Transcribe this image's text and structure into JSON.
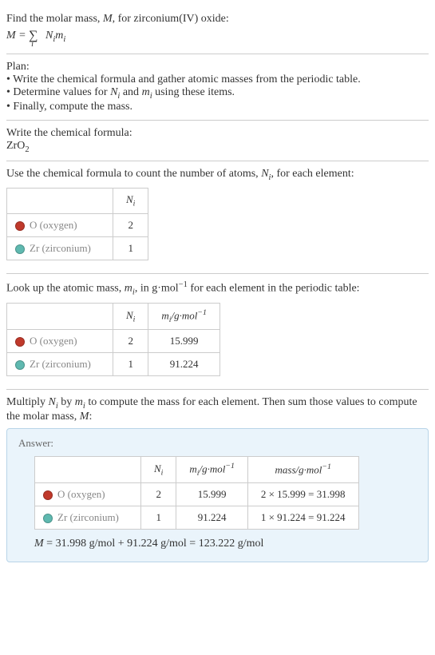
{
  "intro": {
    "line1_a": "Find the molar mass, ",
    "line1_b": ", for zirconium(IV) oxide:",
    "M": "M",
    "eq_lhs": "M = ",
    "sigma": "∑",
    "sigma_sub": "i",
    "eq_rhs_a": "N",
    "eq_rhs_b": "m"
  },
  "plan": {
    "title": "Plan:",
    "b1_a": "• Write the chemical formula and gather atomic masses from the periodic table.",
    "b2_a": "• Determine values for ",
    "b2_b": " and ",
    "b2_c": " using these items.",
    "b3": "• Finally, compute the mass."
  },
  "formula_section": {
    "title": "Write the chemical formula:",
    "zr": "ZrO",
    "sub2": "2"
  },
  "count_section": {
    "text_a": "Use the chemical formula to count the number of atoms, ",
    "text_b": ", for each element:",
    "N": "N",
    "i": "i"
  },
  "mass_section": {
    "text_a": "Look up the atomic mass, ",
    "text_b": ", in g·mol",
    "text_c": " for each element in the periodic table:",
    "m": "m",
    "i": "i",
    "neg1": "−1"
  },
  "multiply_section": {
    "text_a": "Multiply ",
    "text_b": " by ",
    "text_c": " to compute the mass for each element. Then sum those values to compute the molar mass, ",
    "text_d": ":",
    "N": "N",
    "m": "m",
    "i": "i",
    "M": "M"
  },
  "answer": {
    "label": "Answer:",
    "final_a": "M",
    "final_b": " = 31.998 g/mol + 91.224 g/mol = 123.222 g/mol"
  },
  "headers": {
    "N": "N",
    "m": "m",
    "i": "i",
    "gmol": "/g·mol",
    "neg1": "−1",
    "mass": "mass/g·mol"
  },
  "elements": {
    "o_name": "O (oxygen)",
    "zr_name": "Zr (zirconium)"
  },
  "chart_data": {
    "type": "table",
    "rows": [
      {
        "element": "O (oxygen)",
        "N_i": 2,
        "m_i": 15.999,
        "mass_expr": "2 × 15.999 = 31.998"
      },
      {
        "element": "Zr (zirconium)",
        "N_i": 1,
        "m_i": 91.224,
        "mass_expr": "1 × 91.224 = 91.224"
      }
    ],
    "molar_mass": 123.222
  },
  "vals": {
    "o_n": "2",
    "zr_n": "1",
    "o_m": "15.999",
    "zr_m": "91.224",
    "o_mass": "2 × 15.999 = 31.998",
    "zr_mass": "1 × 91.224 = 91.224"
  }
}
